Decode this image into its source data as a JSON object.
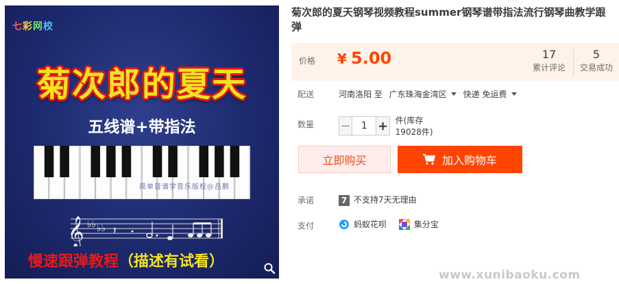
{
  "product_image": {
    "brand_chars": [
      "七",
      "彩",
      "网",
      "校"
    ],
    "brand_colors": [
      "#ff5a5a",
      "#ffd23a",
      "#6be36b",
      "#4fc3ff"
    ],
    "big_title": "菊次郎的夏天",
    "subtitle": "五线谱+带指法",
    "watermark": "简单音谱学音乐版权@吕鹏",
    "bottom_red": "慢速跟弹教程",
    "bottom_paren_open": "（",
    "bottom_yellow": "描述有试看",
    "bottom_paren_close": "）",
    "zoom_icon": "magnifier-icon"
  },
  "product": {
    "title": "菊次郎的夏天钢琴视频教程summer钢琴谱带指法流行钢琴曲教学跟弹",
    "price_label": "价格",
    "currency": "¥",
    "price": "5.00",
    "reviews_count": "17",
    "reviews_label": "累计评论",
    "sales_count": "5",
    "sales_label": "交易成功"
  },
  "shipping": {
    "label": "配送",
    "from": "河南洛阳 至",
    "to": "广东珠海金湾区",
    "method": "快递 免运费"
  },
  "quantity": {
    "label": "数量",
    "minus": "−",
    "value": "1",
    "plus": "+",
    "stock": "件(库存19028件)"
  },
  "actions": {
    "buy_now": "立即购买",
    "add_to_cart": "加入购物车"
  },
  "promise": {
    "label": "承诺",
    "badge": "7",
    "text": "不支持7天无理由"
  },
  "payment": {
    "label": "支付",
    "methods": [
      "蚂蚁花呗",
      "集分宝"
    ]
  },
  "site_watermark": "www.xunibaoku.com",
  "colors": {
    "price": "#ff4400",
    "cart_button": "#ff4400",
    "buy_button_bg": "#ffeded",
    "price_box_bg": "#fff2e8"
  }
}
